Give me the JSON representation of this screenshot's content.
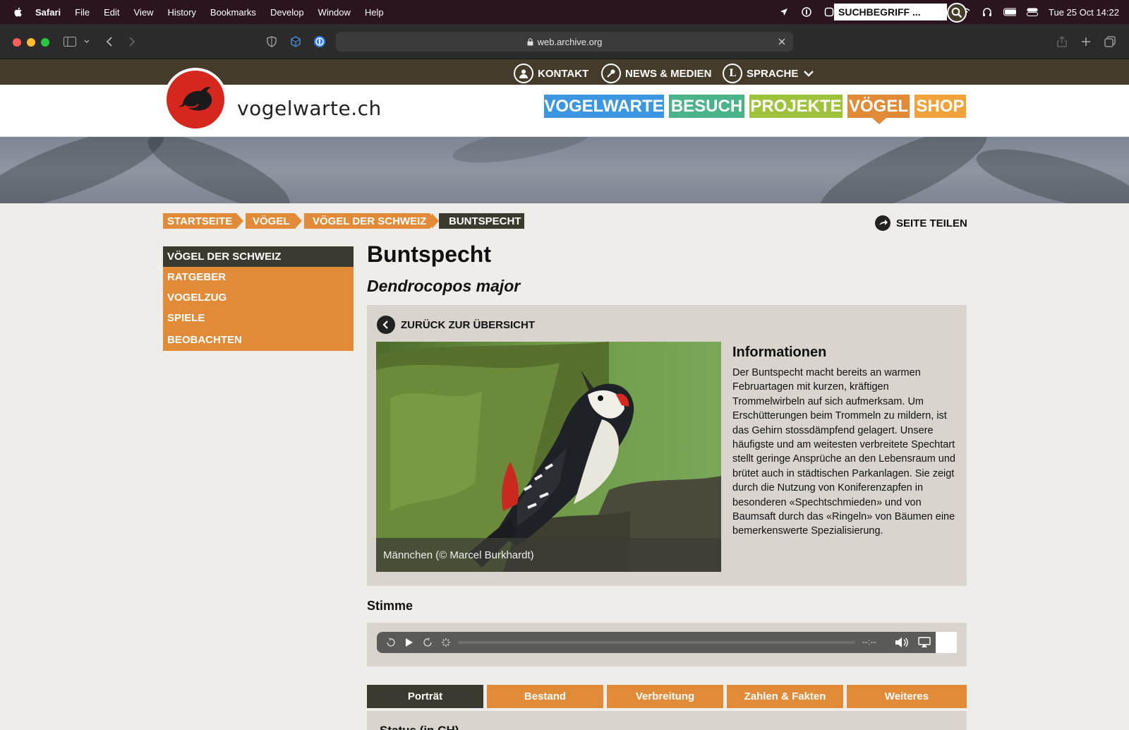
{
  "menubar": {
    "app": "Safari",
    "items": [
      "File",
      "Edit",
      "View",
      "History",
      "Bookmarks",
      "Develop",
      "Window",
      "Help"
    ],
    "datetime": "Tue 25 Oct  14:22"
  },
  "browser": {
    "url": "web.archive.org"
  },
  "site": {
    "logo_text": "vogelwarte.ch",
    "utility": {
      "kontakt": "KONTAKT",
      "news": "NEWS & MEDIEN",
      "sprache": "SPRACHE",
      "search_placeholder": "SUCHBEGRIFF ..."
    },
    "nav": [
      {
        "label": "VOGELWARTE",
        "color": "#3d97e0"
      },
      {
        "label": "BESUCH",
        "color": "#4bb38a"
      },
      {
        "label": "PROJEKTE",
        "color": "#9fc23b"
      },
      {
        "label": "VÖGEL",
        "color": "#e18b38"
      },
      {
        "label": "SHOP",
        "color": "#efa33a"
      }
    ]
  },
  "breadcrumb": [
    "STARTSEITE",
    "VÖGEL",
    "VÖGEL DER SCHWEIZ",
    "BUNTSPECHT"
  ],
  "share_label": "SEITE TEILEN",
  "sidebar": [
    "VÖGEL DER SCHWEIZ",
    "RATGEBER",
    "VOGELZUG",
    "SPIELE",
    "BEOBACHTEN"
  ],
  "main": {
    "title": "Buntspecht",
    "latin": "Dendrocopos major",
    "back_label": "ZURÜCK ZUR ÜBERSICHT",
    "image_caption": "Männchen (© Marcel Burkhardt)",
    "info_heading": "Informationen",
    "info_text": "Der Buntspecht macht bereits an warmen Februartagen mit kurzen, kräftigen Trommelwirbeln auf sich aufmerksam. Um Erschütterungen beim Trommeln zu mildern, ist das Gehirn stossdämpfend gelagert. Unsere häufigste und am weitesten verbreitete Spechtart stellt geringe Ansprüche an den Lebensraum und brütet auch in städtischen Parkanlagen. Sie zeigt durch die Nutzung von Koniferenzapfen in besonderen «Spechtschmieden» und von Baumsaft durch das «Ringeln» von Bäumen eine bemerkenswerte Spezialisierung.",
    "stimme_heading": "Stimme",
    "player_time": "--:--",
    "tabs": [
      "Porträt",
      "Bestand",
      "Verbreitung",
      "Zahlen & Fakten",
      "Weiteres"
    ],
    "status_heading": "Status (in CH)"
  },
  "colors": {
    "orange": "#e18b38",
    "dark": "#3a3a2e",
    "topbar": "#453b2b",
    "logo_red": "#d5271e"
  }
}
